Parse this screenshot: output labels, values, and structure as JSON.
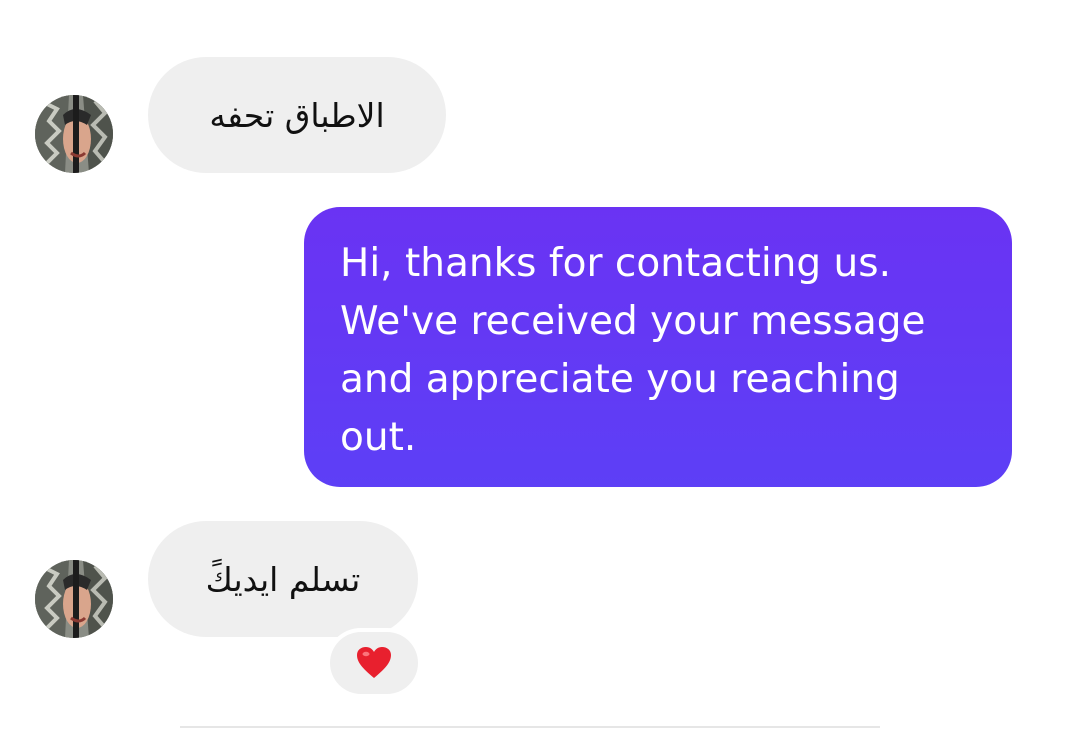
{
  "conversation": {
    "messages": [
      {
        "direction": "incoming",
        "text": "الاطباق تحفه"
      },
      {
        "direction": "outgoing",
        "text": "Hi, thanks for contacting us. We've received your message and appreciate you reaching out."
      },
      {
        "direction": "incoming",
        "text": "تسلم ايديكً",
        "reaction": "heart"
      }
    ]
  },
  "colors": {
    "outgoing_bubble_top": "#6a33f3",
    "outgoing_bubble_bottom": "#5d3ff6",
    "incoming_bubble": "#efefef",
    "reaction_heart": "#e8202e"
  },
  "icons": {
    "avatar": "contact-avatar",
    "reaction": "heart-icon"
  }
}
